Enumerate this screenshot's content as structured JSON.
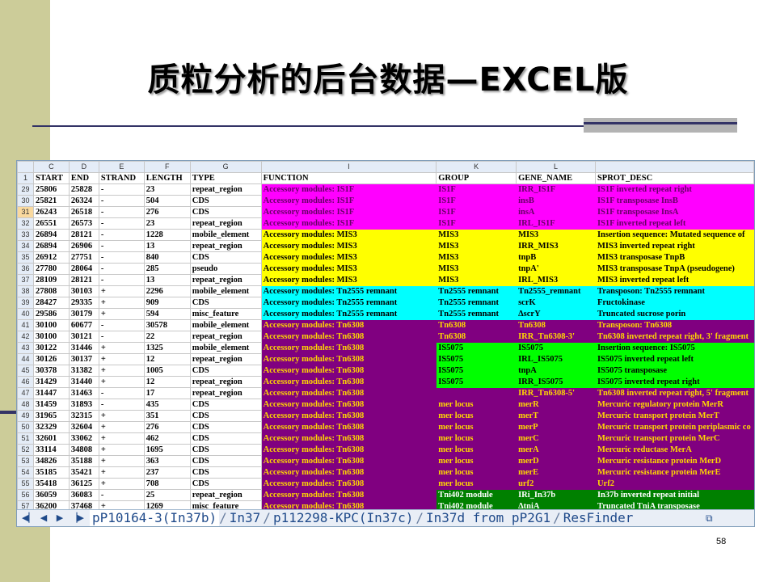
{
  "slide": {
    "title": "质粒分析的后台数据—EXCEL版",
    "page_number": "58"
  },
  "colors": {
    "magenta": "#ff00ff",
    "yellow": "#ffff00",
    "cyan": "#00ffff",
    "purple": "#800080",
    "green": "#00ff00",
    "darkgreen": "#008000"
  },
  "sheet": {
    "column_letters": [
      "",
      "C",
      "D",
      "E",
      "F",
      "G",
      "I",
      "K",
      "L",
      ""
    ],
    "header_row": {
      "num": "1",
      "cells": [
        "START",
        "END",
        "STRAND",
        "LENGTH",
        "TYPE",
        "FUNCTION",
        "GROUP",
        "GENE_NAME",
        "SPROT_DESC"
      ]
    },
    "rows": [
      {
        "num": "29",
        "cells": [
          "25806",
          "25828",
          "-",
          "23",
          "repeat_region"
        ],
        "color": "magenta",
        "func": "Accessory modules: IS1F",
        "group": "IS1F",
        "gene": "IRR_IS1F",
        "desc": "IS1F inverted repeat right"
      },
      {
        "num": "30",
        "cells": [
          "25821",
          "26324",
          "-",
          "504",
          "CDS"
        ],
        "color": "magenta",
        "func": "Accessory modules: IS1F",
        "group": "IS1F",
        "gene": "insB",
        "desc": "IS1F transposase InsB"
      },
      {
        "num": "31",
        "cells": [
          "26243",
          "26518",
          "-",
          "276",
          "CDS"
        ],
        "color": "magenta",
        "func": "Accessory modules: IS1F",
        "group": "IS1F",
        "gene": "insA",
        "desc": "IS1F transposase InsA"
      },
      {
        "num": "32",
        "cells": [
          "26551",
          "26573",
          "-",
          "23",
          "repeat_region"
        ],
        "color": "magenta",
        "func": "Accessory modules: IS1F",
        "group": "IS1F",
        "gene": "IRL_IS1F",
        "desc": "IS1F inverted repeat left"
      },
      {
        "num": "33",
        "cells": [
          "26894",
          "28121",
          "-",
          "1228",
          "mobile_element"
        ],
        "color": "yellow",
        "func": "Accessory modules: MIS3",
        "group": "MIS3",
        "gene": "MIS3",
        "desc": "Insertion sequence: Mutated sequence of"
      },
      {
        "num": "34",
        "cells": [
          "26894",
          "26906",
          "-",
          "13",
          "repeat_region"
        ],
        "color": "yellow",
        "func": "Accessory modules: MIS3",
        "group": "MIS3",
        "gene": "IRR_MIS3",
        "desc": "MIS3 inverted repeat right"
      },
      {
        "num": "35",
        "cells": [
          "26912",
          "27751",
          "-",
          "840",
          "CDS"
        ],
        "color": "yellow",
        "func": "Accessory modules: MIS3",
        "group": "MIS3",
        "gene": "tnpB",
        "desc": "MIS3 transposase TnpB"
      },
      {
        "num": "36",
        "cells": [
          "27780",
          "28064",
          "-",
          "285",
          "pseudo"
        ],
        "color": "yellow",
        "func": "Accessory modules: MIS3",
        "group": "MIS3",
        "gene": "tnpA'",
        "desc": "MIS3 transposase TnpA (pseudogene)"
      },
      {
        "num": "37",
        "cells": [
          "28109",
          "28121",
          "-",
          "13",
          "repeat_region"
        ],
        "color": "yellow",
        "func": "Accessory modules: MIS3",
        "group": "MIS3",
        "gene": "IRL_MIS3",
        "desc": "MIS3 inverted repeat left"
      },
      {
        "num": "38",
        "cells": [
          "27808",
          "30103",
          "+",
          "2296",
          "mobile_element"
        ],
        "color": "cyan",
        "func": "Accessory modules: Tn2555 remnant",
        "group": "Tn2555 remnant",
        "gene": "Tn2555_remnant",
        "desc": "Transposon: Tn2555 remnant"
      },
      {
        "num": "39",
        "cells": [
          "28427",
          "29335",
          "+",
          "909",
          "CDS"
        ],
        "color": "cyan",
        "func": "Accessory modules: Tn2555 remnant",
        "group": "Tn2555 remnant",
        "gene": "scrK",
        "desc": "Fructokinase"
      },
      {
        "num": "40",
        "cells": [
          "29586",
          "30179",
          "+",
          "594",
          "misc_feature"
        ],
        "color": "cyan",
        "func": "Accessory modules: Tn2555 remnant",
        "group": "Tn2555 remnant",
        "gene": "ΔscrY",
        "desc": "Truncated sucrose porin"
      },
      {
        "num": "41",
        "cells": [
          "30100",
          "60677",
          "-",
          "30578",
          "mobile_element"
        ],
        "color": "purple",
        "func": "Accessory modules: Tn6308",
        "group": "Tn6308",
        "gene": "Tn6308",
        "desc": "Transposon: Tn6308"
      },
      {
        "num": "42",
        "cells": [
          "30100",
          "30121",
          "-",
          "22",
          "repeat_region"
        ],
        "color": "purple",
        "func": "Accessory modules: Tn6308",
        "group": "Tn6308",
        "gene": "IRR_Tn6308-3'",
        "desc": "Tn6308 inverted repeat right, 3' fragment"
      },
      {
        "num": "43",
        "cells": [
          "30122",
          "31446",
          "+",
          "1325",
          "mobile_element"
        ],
        "color": "purple",
        "func": "Accessory modules: Tn6308",
        "group": "IS5075",
        "gene": "IS5075",
        "desc": "Insertion sequence: IS5075",
        "right": "green"
      },
      {
        "num": "44",
        "cells": [
          "30126",
          "30137",
          "+",
          "12",
          "repeat_region"
        ],
        "color": "purple",
        "func": "Accessory modules: Tn6308",
        "group": "IS5075",
        "gene": "IRL_IS5075",
        "desc": "IS5075 inverted repeat left",
        "right": "green"
      },
      {
        "num": "45",
        "cells": [
          "30378",
          "31382",
          "+",
          "1005",
          "CDS"
        ],
        "color": "purple",
        "func": "Accessory modules: Tn6308",
        "group": "IS5075",
        "gene": "tnpA",
        "desc": "IS5075 transposase",
        "right": "green"
      },
      {
        "num": "46",
        "cells": [
          "31429",
          "31440",
          "+",
          "12",
          "repeat_region"
        ],
        "color": "purple",
        "func": "Accessory modules: Tn6308",
        "group": "IS5075",
        "gene": "IRR_IS5075",
        "desc": "IS5075 inverted repeat right",
        "right": "green"
      },
      {
        "num": "47",
        "cells": [
          "31447",
          "31463",
          "-",
          "17",
          "repeat_region"
        ],
        "color": "purple",
        "func": "Accessory modules: Tn6308",
        "group": "",
        "gene": "IRR_Tn6308-5'",
        "desc": "Tn6308 inverted repeat right, 5' fragment"
      },
      {
        "num": "48",
        "cells": [
          "31459",
          "31893",
          "-",
          "435",
          "CDS"
        ],
        "color": "purple",
        "func": "Accessory modules: Tn6308",
        "group": "mer locus",
        "gene": "merR",
        "desc": "Mercuric regulatory protein MerR"
      },
      {
        "num": "49",
        "cells": [
          "31965",
          "32315",
          "+",
          "351",
          "CDS"
        ],
        "color": "purple",
        "func": "Accessory modules: Tn6308",
        "group": "mer locus",
        "gene": "merT",
        "desc": "Mercuric transport protein MerT"
      },
      {
        "num": "50",
        "cells": [
          "32329",
          "32604",
          "+",
          "276",
          "CDS"
        ],
        "color": "purple",
        "func": "Accessory modules: Tn6308",
        "group": "mer locus",
        "gene": "merP",
        "desc": "Mercuric transport protein periplasmic co"
      },
      {
        "num": "51",
        "cells": [
          "32601",
          "33062",
          "+",
          "462",
          "CDS"
        ],
        "color": "purple",
        "func": "Accessory modules: Tn6308",
        "group": "mer locus",
        "gene": "merC",
        "desc": "Mercuric transport protein MerC"
      },
      {
        "num": "52",
        "cells": [
          "33114",
          "34808",
          "+",
          "1695",
          "CDS"
        ],
        "color": "purple",
        "func": "Accessory modules: Tn6308",
        "group": "mer locus",
        "gene": "merA",
        "desc": "Mercuric reductase MerA"
      },
      {
        "num": "53",
        "cells": [
          "34826",
          "35188",
          "+",
          "363",
          "CDS"
        ],
        "color": "purple",
        "func": "Accessory modules: Tn6308",
        "group": "mer locus",
        "gene": "merD",
        "desc": "Mercuric resistance protein MerD"
      },
      {
        "num": "54",
        "cells": [
          "35185",
          "35421",
          "+",
          "237",
          "CDS"
        ],
        "color": "purple",
        "func": "Accessory modules: Tn6308",
        "group": "mer locus",
        "gene": "merE",
        "desc": "Mercuric resistance protein MerE"
      },
      {
        "num": "55",
        "cells": [
          "35418",
          "36125",
          "+",
          "708",
          "CDS"
        ],
        "color": "purple",
        "func": "Accessory modules: Tn6308",
        "group": "mer locus",
        "gene": "urf2",
        "desc": "Urf2"
      },
      {
        "num": "56",
        "cells": [
          "36059",
          "36083",
          "-",
          "25",
          "repeat_region"
        ],
        "color": "purple",
        "func": "Accessory modules: Tn6308",
        "group": "Tni402 module",
        "gene": "IRi_In37b",
        "desc": "In37b inverted repeat initial",
        "right": "darkgreen"
      },
      {
        "num": "57",
        "cells": [
          "36200",
          "37468",
          "+",
          "1269",
          "misc_feature"
        ],
        "color": "purple",
        "func": "Accessory modules: Tn6308",
        "group": "Tni402 module",
        "gene": "ΔtniA",
        "desc": "Truncated TniA transposase",
        "right": "darkgreen"
      }
    ],
    "selected_row": "31",
    "tabs": [
      "pP10164-3(In37b)",
      "In37",
      "p112298-KPC(In37c)",
      "In37d from pP2G1",
      "ResFinder"
    ],
    "active_tab": 0
  },
  "icons": {
    "nav": [
      "first-sheet-icon",
      "prev-sheet-icon",
      "next-sheet-icon",
      "last-sheet-icon"
    ],
    "new_sheet": "insert-sheet-icon"
  }
}
